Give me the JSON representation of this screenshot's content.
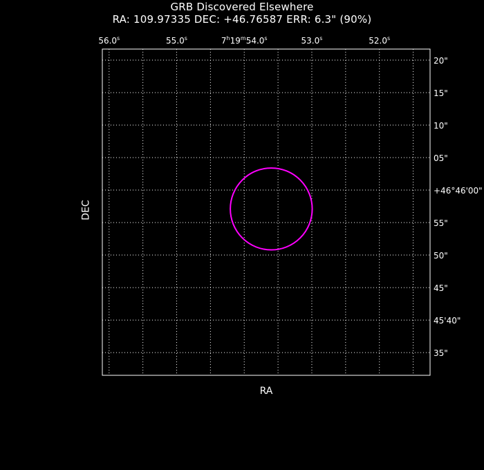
{
  "header": {
    "title": "GRB Discovered Elsewhere",
    "subtitle": "RA: 109.97335   DEC: +46.76587   ERR: 6.3\" (90%)"
  },
  "colors": {
    "background": "#000000",
    "foreground": "#ffffff",
    "error_circle": "#ff00ff"
  },
  "chart_data": {
    "type": "scatter",
    "xlabel": "RA",
    "ylabel": "DEC",
    "grid": true,
    "x_units": "seconds of RA (7h19m + value)",
    "y_units": "arcseconds of DEC (+46°45' + value)",
    "xlim": [
      56.1,
      51.25
    ],
    "ylim": [
      31.5,
      81.7
    ],
    "x_ticks": [
      {
        "value": 56.0,
        "label": "56.0",
        "sup": "s",
        "prefix": "",
        "prefix_sup": ""
      },
      {
        "value": 55.0,
        "label": "55.0",
        "sup": "s",
        "prefix": "",
        "prefix_sup": ""
      },
      {
        "value": 54.0,
        "label": "54.0",
        "sup": "s",
        "prefix": "7h19m",
        "prefix_sup": ""
      },
      {
        "value": 53.0,
        "label": "53.0",
        "sup": "s",
        "prefix": "",
        "prefix_sup": ""
      },
      {
        "value": 52.0,
        "label": "52.0",
        "sup": "s",
        "prefix": "",
        "prefix_sup": ""
      }
    ],
    "x_minor_grid": [
      55.5,
      54.5,
      53.5,
      52.5,
      51.5
    ],
    "y_ticks": [
      {
        "value": 80,
        "label": "20\""
      },
      {
        "value": 75,
        "label": "15\""
      },
      {
        "value": 70,
        "label": "10\""
      },
      {
        "value": 65,
        "label": "05\""
      },
      {
        "value": 60,
        "label": "+46°46'00\""
      },
      {
        "value": 55,
        "label": "55\""
      },
      {
        "value": 50,
        "label": "50\""
      },
      {
        "value": 45,
        "label": "45\""
      },
      {
        "value": 40,
        "label": "45'40\""
      },
      {
        "value": 35,
        "label": "35\""
      }
    ],
    "error_circle": {
      "ra_deg": 109.97335,
      "dec_deg": 46.76587,
      "center_x": 53.6,
      "center_y": 57.1,
      "radius_arcsec": 6.3,
      "label": "90%"
    }
  }
}
